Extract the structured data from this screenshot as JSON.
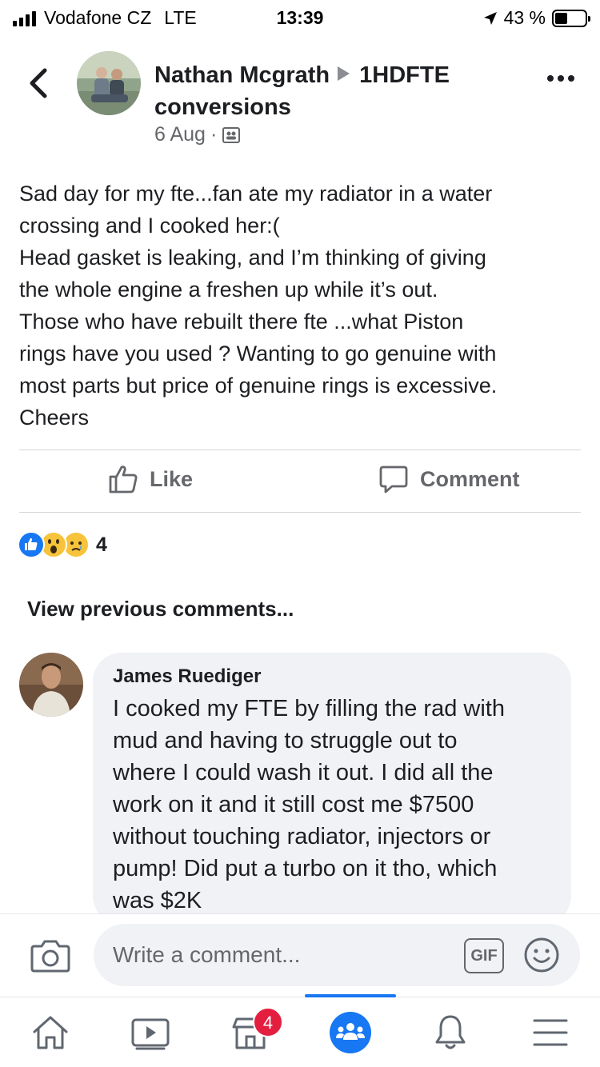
{
  "status_bar": {
    "carrier": "Vodafone CZ",
    "network": "LTE",
    "time": "13:39",
    "battery_percent": "43 %",
    "battery_level": 0.43
  },
  "post": {
    "author": "Nathan Mcgrath",
    "group_line1": "1HDFTE",
    "group_line2": "conversions",
    "date": "6 Aug",
    "separator": "·",
    "audience_icon": "group-audience-icon",
    "text_lines": [
      "Sad day for my fte...fan ate my radiator in a water",
      "crossing and I cooked her:(",
      "Head gasket is leaking, and I’m thinking of giving",
      "the whole engine a freshen up while it’s out.",
      "Those who have rebuilt there fte ...what Piston",
      "rings have you used ? Wanting to go genuine with",
      "most parts but price of genuine rings is excessive.",
      "Cheers"
    ]
  },
  "actions": {
    "like": "Like",
    "comment": "Comment"
  },
  "reactions": {
    "types": [
      "like",
      "wow",
      "sad"
    ],
    "count": "4"
  },
  "comments": {
    "view_previous": "View previous comments...",
    "items": [
      {
        "author": "James Ruediger",
        "text_lines": [
          "I cooked my FTE by filling the rad with",
          "mud and having to struggle out to",
          "where I could wash it out. I did all the",
          "work on it and it still cost me $7500",
          "without touching radiator, injectors or",
          "pump! Did put a turbo on it tho, which",
          "was $2K"
        ]
      }
    ]
  },
  "composer": {
    "placeholder": "Write a comment...",
    "gif_label": "GIF"
  },
  "tab_bar": {
    "tabs": [
      "home",
      "watch",
      "marketplace",
      "groups",
      "notifications",
      "menu"
    ],
    "active": "groups",
    "marketplace_badge": "4"
  },
  "colors": {
    "accent": "#1877f2",
    "badge": "#e41e3f",
    "secondary_text": "#65676b",
    "bubble": "#f0f2f5"
  }
}
